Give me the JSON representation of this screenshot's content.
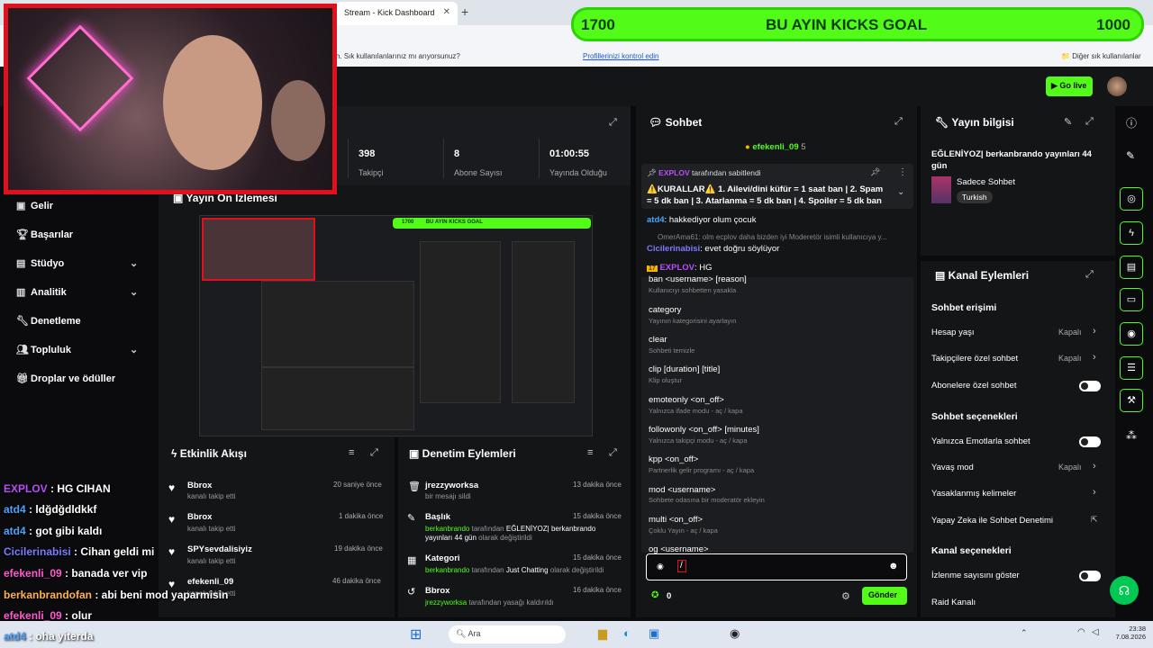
{
  "browser": {
    "tab_title": "Stream - Kick Dashboard",
    "bookmark_message": "Yer işaretlerini, bu işaretleri sık kullanılanlar çubuğuna yerleştirin. Sık kullanılanlarınız mı arıyorsunuz?",
    "bookmark_link": "Profillerinizi kontrol edin",
    "other_favorites": "Diğer sık kullanılanlar"
  },
  "goal_banner": {
    "left": "1700",
    "title": "BU AYIN KICKS GOAL",
    "right": "1000"
  },
  "header": {
    "go_live": "Go live"
  },
  "sidebar": {
    "items": [
      {
        "label": "Gelir",
        "icon": "wallet-icon"
      },
      {
        "label": "Başarılar",
        "icon": "trophy-icon"
      },
      {
        "label": "Stüdyo",
        "icon": "studio-icon"
      },
      {
        "label": "Analitik",
        "icon": "chart-icon"
      },
      {
        "label": "Denetleme",
        "icon": "wrench-icon"
      },
      {
        "label": "Topluluk",
        "icon": "people-icon"
      },
      {
        "label": "Droplar ve ödüller",
        "icon": "gift-icon"
      }
    ]
  },
  "stats": [
    {
      "value": "398",
      "label": "Takipçi"
    },
    {
      "value": "8",
      "label": "Abone Sayısı"
    },
    {
      "value": "01:00:55",
      "label": "Yayında Olduğu"
    }
  ],
  "preview": {
    "title": "Yayın Ön İzlemesi"
  },
  "activity": {
    "title": "Etkinlik Akışı",
    "rows": [
      {
        "name": "Bbrox",
        "sub": "kanalı takip etti",
        "time": "20 saniye önce"
      },
      {
        "name": "Bbrox",
        "sub": "kanalı takip etti",
        "time": "1 dakika önce"
      },
      {
        "name": "SPYsevdalisiyiz",
        "sub": "kanalı takip etti",
        "time": "19 dakika önce"
      },
      {
        "name": "efekenli_09",
        "sub": "kanalı takip etti",
        "time": "46 dakika önce"
      }
    ]
  },
  "moderation": {
    "title": "Denetim Eylemleri",
    "rows": [
      {
        "name": "jrezzyworksa",
        "sub": "bir mesajı sildi",
        "time": "13 dakika önce"
      },
      {
        "name": "Başlık",
        "sub1": "berkanbrando",
        "sub2": " tarafından ",
        "sub3": "EĞLENİYOZ| berkanbrando yayınları 44 gün",
        "sub4": " olarak değiştirildi",
        "time": "15 dakika önce"
      },
      {
        "name": "Kategori",
        "sub1": "berkanbrando",
        "sub2": " tarafından ",
        "sub3": "Just Chatting",
        "sub4": " olarak değiştirildi",
        "time": "15 dakika önce"
      },
      {
        "name": "Bbrox",
        "sub1": "jrezzyworksa",
        "sub2": " tarafından yasağı kaldırıldı",
        "time": "16 dakika önce"
      }
    ]
  },
  "chat": {
    "title": "Sohbet",
    "top_user": "efekenli_09",
    "top_count": "5",
    "pinned_by": "EXPLOV",
    "pinned_by_suffix": "tarafından sabitlendi",
    "pinned_text": "⚠️KURALLAR⚠️ 1. Ailevi/dini küfür = 1 saat ban | 2. Spam = 5 dk ban | 3. Atarlanma = 5 dk ban | 4. Spoiler = 5 dk ban",
    "messages": [
      {
        "user": "atd4",
        "text": ": hakkediyor olum çocuk"
      },
      {
        "user": "OmerAma61",
        "text": ": olm ecplov daha bizden iyi Moderetör isimli kullanıcıya y..."
      },
      {
        "user": "Cicilerinabisi",
        "text": ": evet doğru söylüyor"
      },
      {
        "user": "EXPLOV",
        "text": ": HG"
      }
    ],
    "commands": [
      {
        "cmd": "ban <username> [reason]",
        "desc": "Kullanıcıyı sohbetten yasakla"
      },
      {
        "cmd": "category",
        "desc": "Yayının kategorisini ayarlayın"
      },
      {
        "cmd": "clear",
        "desc": "Sohbeti temizle"
      },
      {
        "cmd": "clip [duration] [title]",
        "desc": "Klip oluştur"
      },
      {
        "cmd": "emoteonly <on_off>",
        "desc": "Yalnızca ifade modu - aç / kapa"
      },
      {
        "cmd": "followonly <on_off> [minutes]",
        "desc": "Yalnızca takipçi modu - aç / kapa"
      },
      {
        "cmd": "kpp <on_off>",
        "desc": "Partnerlik gelir programı - aç / kapa"
      },
      {
        "cmd": "mod <username>",
        "desc": "Sohbete odasına bir moderatör ekleyin"
      },
      {
        "cmd": "multi <on_off>",
        "desc": "Çoklu Yayın - aç / kapa"
      },
      {
        "cmd": "og <username>",
        "desc": ""
      }
    ],
    "input_value": "/",
    "points": "0",
    "send_label": "Gönder"
  },
  "stream_info": {
    "title": "Yayın bilgisi",
    "stream_title": "EĞLENİYOZ| berkanbrando yayınları 44 gün",
    "category": "Sadece Sohbet",
    "language": "Turkish"
  },
  "channel_actions": {
    "title": "Kanal Eylemleri",
    "section1": "Sohbet erişimi",
    "section2": "Sohbet seçenekleri",
    "section3": "Kanal seçenekleri",
    "options": [
      {
        "label": "Hesap yaşı",
        "value": "Kapalı"
      },
      {
        "label": "Takipçilere özel sohbet",
        "value": "Kapalı"
      },
      {
        "label": "Abonelere özel sohbet",
        "value": ""
      },
      {
        "label": "Yalnızca Emotlarla sohbet",
        "value": ""
      },
      {
        "label": "Yavaş mod",
        "value": "Kapalı"
      },
      {
        "label": "Yasaklanmış kelimeler",
        "value": ""
      },
      {
        "label": "Yapay Zeka ile Sohbet Denetimi",
        "value": ""
      },
      {
        "label": "İzlenme sayısını göster",
        "value": ""
      },
      {
        "label": "Raid Kanalı",
        "value": ""
      }
    ]
  },
  "overlay_chat": [
    {
      "user": "EXPLOV",
      "text": " : HG CIHAN",
      "color": "#b84dff"
    },
    {
      "user": "atd4",
      "text": " : ldğdğdldkkf",
      "color": "#4aa3ff"
    },
    {
      "user": "atd4",
      "text": " : got gibi kaldı",
      "color": "#4aa3ff"
    },
    {
      "user": "Cicilerinabisi",
      "text": " : Cihan geldi mi",
      "color": "#7b7bff"
    },
    {
      "user": "efekenli_09",
      "text": " : banada ver vip",
      "color": "#ff5ad1"
    },
    {
      "user": "berkanbrandofan",
      "text": " : abi beni mod yaparmisin",
      "color": "#ffb347"
    },
    {
      "user": "efekenli_09",
      "text": " : olur",
      "color": "#ff5ad1"
    },
    {
      "user": "atd4",
      "text": " : oha yiterda",
      "color": "#4aa3ff"
    }
  ],
  "taskbar": {
    "search_placeholder": "Ara",
    "time": "23:38",
    "date": "7.08.2026"
  }
}
